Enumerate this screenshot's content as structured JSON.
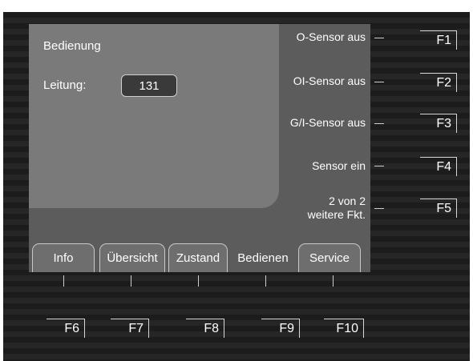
{
  "panel": {
    "title": "Bedienung",
    "field_label": "Leitung:",
    "field_value": "131"
  },
  "tabs": [
    {
      "label": "Info"
    },
    {
      "label": "Übersicht"
    },
    {
      "label": "Zustand"
    },
    {
      "label": "Bedienen"
    },
    {
      "label": "Service"
    }
  ],
  "side_buttons": [
    {
      "label": "O-Sensor aus",
      "key": "F1"
    },
    {
      "label": "OI-Sensor aus",
      "key": "F2"
    },
    {
      "label": "G/I-Sensor aus",
      "key": "F3"
    },
    {
      "label": "Sensor ein",
      "key": "F4"
    },
    {
      "label_line1": "2 von 2",
      "label_line2": "weitere Fkt.",
      "key": "F5"
    }
  ],
  "bottom_keys": [
    "F6",
    "F7",
    "F8",
    "F9",
    "F10"
  ]
}
